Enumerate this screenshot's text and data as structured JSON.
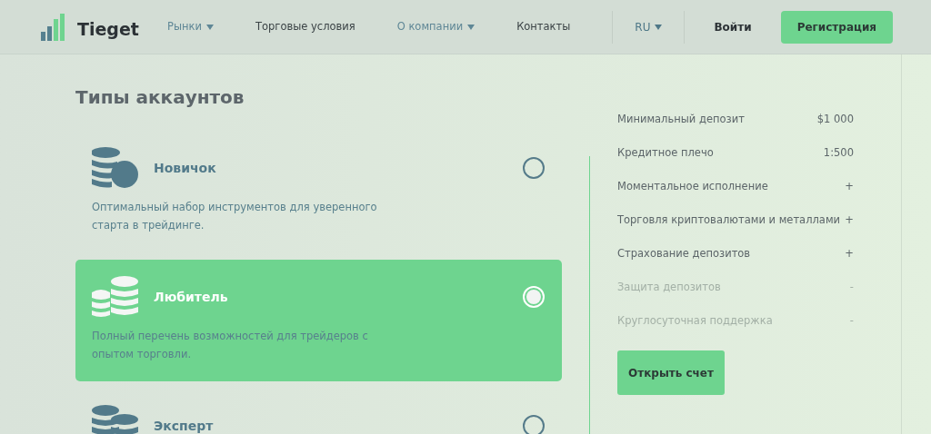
{
  "header": {
    "logo": "Tieget",
    "nav": [
      {
        "label": "Рынки",
        "dropdown": true
      },
      {
        "label": "Торговые условия",
        "dropdown": false
      },
      {
        "label": "О компании",
        "dropdown": true
      },
      {
        "label": "Контакты",
        "dropdown": false
      }
    ],
    "language": "RU",
    "login": "Войти",
    "register": "Регистрация"
  },
  "title": "Типы аккаунтов",
  "accounts": [
    {
      "name": "Новичок",
      "description": "Оптимальный набор инструментов для уверенного старта в трейдинге.",
      "selected": false
    },
    {
      "name": "Любитель",
      "description": "Полный перечень возможностей для трейдеров с опытом торговли.",
      "selected": true
    },
    {
      "name": "Эксперт",
      "selected": false
    }
  ],
  "features": [
    {
      "label": "Минимальный депозит",
      "value": "$1 000",
      "disabled": false
    },
    {
      "label": "Кредитное плечо",
      "value": "1:500",
      "disabled": false
    },
    {
      "label": "Моментальное исполнение",
      "value": "+",
      "disabled": false
    },
    {
      "label": "Торговля криптовалютами и металлами",
      "value": "+",
      "disabled": false
    },
    {
      "label": "Страхование депозитов",
      "value": "+",
      "disabled": false
    },
    {
      "label": "Защита депозитов",
      "value": "-",
      "disabled": true
    },
    {
      "label": "Круглосуточная поддержка",
      "value": "-",
      "disabled": true
    }
  ],
  "open_account": "Открыть счет"
}
